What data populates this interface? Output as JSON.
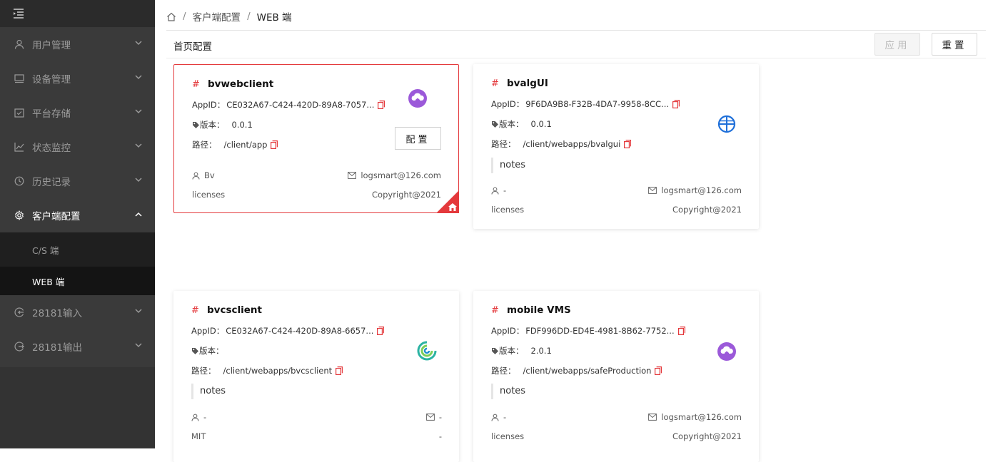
{
  "sidebar": {
    "items": [
      {
        "label": "用户管理",
        "icon": "user-icon"
      },
      {
        "label": "设备管理",
        "icon": "monitor-icon"
      },
      {
        "label": "平台存储",
        "icon": "calendar-check-icon"
      },
      {
        "label": "状态监控",
        "icon": "line-chart-icon"
      },
      {
        "label": "历史记录",
        "icon": "history-icon"
      },
      {
        "label": "客户端配置",
        "icon": "gear-icon"
      }
    ],
    "sub_items": [
      {
        "label": "C/S 端"
      },
      {
        "label": "WEB 端"
      }
    ],
    "bottom_items": [
      {
        "label": "28181输入",
        "icon": "import-icon"
      },
      {
        "label": "28181输出",
        "icon": "export-icon"
      }
    ]
  },
  "breadcrumb": {
    "level1": "客户端配置",
    "level2": "WEB 端",
    "sep": "/"
  },
  "toolbar": {
    "title": "首页配置",
    "apply_label": "应用",
    "reset_label": "重置"
  },
  "labels": {
    "appid": "AppID：",
    "version": "版本：",
    "path": "路径：",
    "config_button": "配置"
  },
  "cards": [
    {
      "name": "bvwebclient",
      "appid": "CE032A67-C424-420D-89A8-7057...",
      "version": "0.0.1",
      "path": "/client/app",
      "notes": "",
      "author": "Bv",
      "email": "logsmart@126.com",
      "license": "licenses",
      "copyright": "Copyright@2021",
      "icon": "purple-cloud-home-icon"
    },
    {
      "name": "bvalgUI",
      "appid": "9F6DA9B8-F32B-4DA7-9958-8CC...",
      "version": "0.0.1",
      "path": "/client/webapps/bvalgui",
      "notes": "notes",
      "author": "-",
      "email": "logsmart@126.com",
      "license": "licenses",
      "copyright": "Copyright@2021",
      "icon": "blue-globe-icon"
    },
    {
      "name": "bvcsclient",
      "appid": "CE032A67-C424-420D-89A8-6657...",
      "version": "",
      "path": "/client/webapps/bvcsclient",
      "notes": "notes",
      "author": "-",
      "email": "-",
      "license": "MIT",
      "copyright": "-",
      "icon": "green-swirl-icon"
    },
    {
      "name": "mobile VMS",
      "appid": "FDF996DD-ED4E-4981-8B62-7752...",
      "version": "2.0.1",
      "path": "/client/webapps/safeProduction",
      "notes": "notes",
      "author": "-",
      "email": "logsmart@126.com",
      "license": "licenses",
      "copyright": "Copyright@2021",
      "icon": "purple-cloud-home-icon"
    }
  ],
  "colors": {
    "accent": "#e4393c",
    "sidebar_bg": "#3a3a3a",
    "active_bg": "#141414"
  }
}
